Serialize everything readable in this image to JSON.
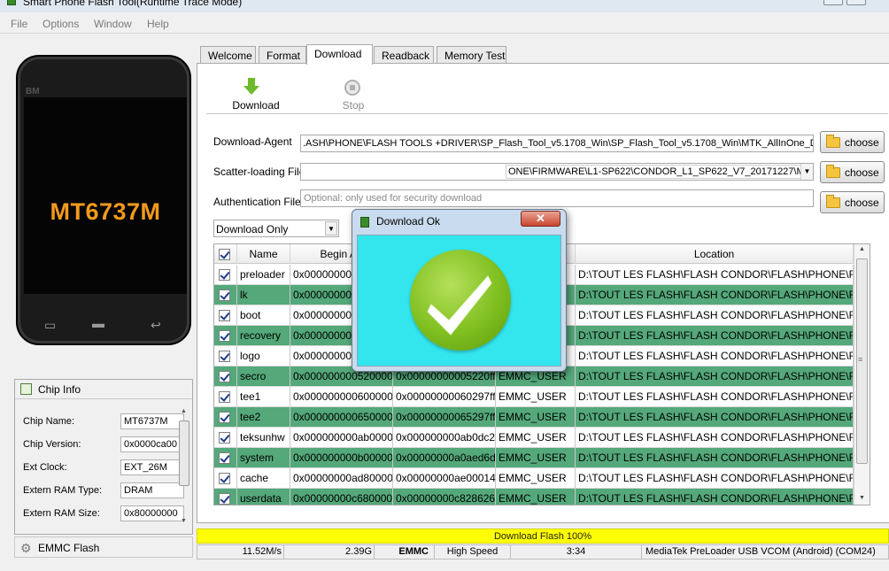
{
  "window": {
    "title": "Smart Phone Flash Tool(Runtime Trace Mode)"
  },
  "menu": [
    "File",
    "Options",
    "Window",
    "Help"
  ],
  "phone": {
    "brand": "BM",
    "chip_display": "MT6737M"
  },
  "chip_info": {
    "title": "Chip Info",
    "rows": [
      {
        "label": "Chip Name:",
        "value": "MT6737M"
      },
      {
        "label": "Chip Version:",
        "value": "0x0000ca00"
      },
      {
        "label": "Ext Clock:",
        "value": "EXT_26M"
      },
      {
        "label": "Extern RAM Type:",
        "value": "DRAM"
      },
      {
        "label": "Extern RAM Size:",
        "value": "0x80000000"
      }
    ]
  },
  "emmc_flash_label": "EMMC Flash",
  "tabs": [
    "Welcome",
    "Format",
    "Download",
    "Readback",
    "Memory Test"
  ],
  "active_tab": "Download",
  "toolbar": {
    "download_label": "Download",
    "stop_label": "Stop"
  },
  "form": {
    "download_agent_label": "Download-Agent",
    "download_agent_value": ".ASH\\PHONE\\FLASH TOOLS +DRIVER\\SP_Flash_Tool_v5.1708_Win\\SP_Flash_Tool_v5.1708_Win\\MTK_AllInOne_DA.bin",
    "scatter_label": "Scatter-loading File",
    "scatter_value": "ONE\\FIRMWARE\\L1-SP622\\CONDOR_L1_SP622_V7_20171227\\MT67",
    "auth_label": "Authentication File",
    "auth_placeholder": "Optional: only used for security download",
    "choose_label": "choose",
    "mode_value": "Download Only"
  },
  "table": {
    "headers": [
      "Name",
      "Begin Ad",
      "",
      "",
      "Location"
    ],
    "rows": [
      {
        "name": "preloader",
        "begin": "0x000000000",
        "end": "",
        "region": "",
        "location": "D:\\TOUT LES FLASH\\FLASH CONDOR\\FLASH\\PHONE\\FI...",
        "color": "white"
      },
      {
        "name": "lk",
        "begin": "0x000000000",
        "end": "",
        "region": "",
        "location": "D:\\TOUT LES FLASH\\FLASH CONDOR\\FLASH\\PHONE\\FI...",
        "color": "green"
      },
      {
        "name": "boot",
        "begin": "0x000000000",
        "end": "",
        "region": "",
        "location": "D:\\TOUT LES FLASH\\FLASH CONDOR\\FLASH\\PHONE\\FI...",
        "color": "white"
      },
      {
        "name": "recovery",
        "begin": "0x000000000",
        "end": "",
        "region": "",
        "location": "D:\\TOUT LES FLASH\\FLASH CONDOR\\FLASH\\PHONE\\FI...",
        "color": "green"
      },
      {
        "name": "logo",
        "begin": "0x000000000",
        "end": "",
        "region": "",
        "location": "D:\\TOUT LES FLASH\\FLASH CONDOR\\FLASH\\PHONE\\FI...",
        "color": "white"
      },
      {
        "name": "secro",
        "begin": "0x0000000005200000",
        "end": "0x00000000005220ff",
        "region": "EMMC_USER",
        "location": "D:\\TOUT LES FLASH\\FLASH CONDOR\\FLASH\\PHONE\\FI...",
        "color": "green"
      },
      {
        "name": "tee1",
        "begin": "0x0000000006000000",
        "end": "0x00000000060297ff",
        "region": "EMMC_USER",
        "location": "D:\\TOUT LES FLASH\\FLASH CONDOR\\FLASH\\PHONE\\FI...",
        "color": "white"
      },
      {
        "name": "tee2",
        "begin": "0x0000000006500000",
        "end": "0x00000000065297ff",
        "region": "EMMC_USER",
        "location": "D:\\TOUT LES FLASH\\FLASH CONDOR\\FLASH\\PHONE\\FI...",
        "color": "green"
      },
      {
        "name": "teksunhw",
        "begin": "0x000000000ab00000",
        "end": "0x000000000ab0dc2b",
        "region": "EMMC_USER",
        "location": "D:\\TOUT LES FLASH\\FLASH CONDOR\\FLASH\\PHONE\\FI...",
        "color": "white"
      },
      {
        "name": "system",
        "begin": "0x000000000b000000",
        "end": "0x00000000a0aed6db",
        "region": "EMMC_USER",
        "location": "D:\\TOUT LES FLASH\\FLASH CONDOR\\FLASH\\PHONE\\FI...",
        "color": "green"
      },
      {
        "name": "cache",
        "begin": "0x00000000ad800000",
        "end": "0x00000000ae000147",
        "region": "EMMC_USER",
        "location": "D:\\TOUT LES FLASH\\FLASH CONDOR\\FLASH\\PHONE\\FI...",
        "color": "white"
      },
      {
        "name": "userdata",
        "begin": "0x00000000c6800000",
        "end": "0x00000000c8286267",
        "region": "EMMC_USER",
        "location": "D:\\TOUT LES FLASH\\FLASH CONDOR\\FLASH\\PHONE\\FI...",
        "color": "green"
      }
    ]
  },
  "progress": {
    "label": "Download Flash 100%",
    "percent": 100,
    "color": "#ffff00"
  },
  "status_bar": [
    "11.52M/s",
    "2.39G",
    "EMMC",
    "High Speed",
    "3:34",
    "MediaTek PreLoader USB VCOM (Android) (COM24)"
  ],
  "dialog": {
    "title": "Download Ok",
    "close_glyph": "✕",
    "body_color": "#33e5ec"
  },
  "colors": {
    "row_green": "#54a87a",
    "chip_text": "#f39a1c",
    "ok_green": "#7fbf1f"
  }
}
